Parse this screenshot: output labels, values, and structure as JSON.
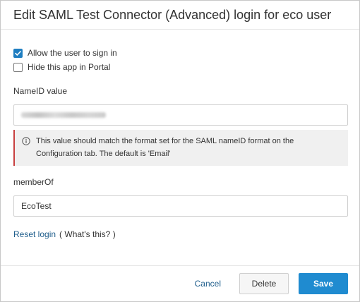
{
  "dialog": {
    "title": "Edit SAML Test Connector (Advanced) login for eco user"
  },
  "options": {
    "allow_sign_in": {
      "label": "Allow the user to sign in",
      "checked": true
    },
    "hide_in_portal": {
      "label": "Hide this app in Portal",
      "checked": false
    }
  },
  "nameid": {
    "label": "NameID value",
    "value_obscured": true,
    "info": "This value should match the format set for the SAML nameID format on the Configuration tab. The default is 'Email'"
  },
  "memberof": {
    "label": "memberOf",
    "value": "EcoTest"
  },
  "links": {
    "reset_login": "Reset login",
    "whats_this": "( What's this? )"
  },
  "footer": {
    "cancel": "Cancel",
    "delete": "Delete",
    "save": "Save"
  },
  "colors": {
    "accent": "#1f8bd0",
    "link": "#1f5e8c",
    "info_border": "#c84040"
  },
  "icons": [
    "checkmark-icon",
    "info-icon"
  ]
}
